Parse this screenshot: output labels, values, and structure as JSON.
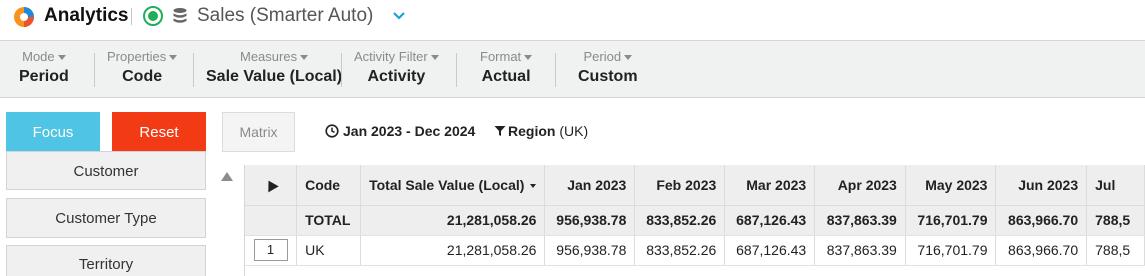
{
  "header": {
    "app_title": "Analytics",
    "dataset_title": "Sales (Smarter Auto)",
    "status_color": "#1fae5a",
    "icons": [
      "analytics-logo-icon",
      "status-online-icon",
      "database-icon",
      "chevron-down-icon"
    ]
  },
  "toolbar": {
    "groups": [
      {
        "caption": "Mode",
        "value": "Period"
      },
      {
        "caption": "Properties",
        "value": "Code"
      },
      {
        "caption": "Measures",
        "value": "Sale Value (Local)"
      },
      {
        "caption": "Activity Filter",
        "value": "Activity"
      },
      {
        "caption": "Format",
        "value": "Actual"
      },
      {
        "caption": "Period",
        "value": "Custom"
      }
    ]
  },
  "actions": {
    "focus_label": "Focus",
    "reset_label": "Reset",
    "matrix_label": "Matrix",
    "date_range": "Jan 2023 - Dec 2024",
    "filter_name": "Region",
    "filter_value": "(UK)",
    "focus_color": "#4fc4e5",
    "reset_color": "#f23a14"
  },
  "sidebar": {
    "items": [
      {
        "label": "Customer"
      },
      {
        "label": "Customer Type"
      },
      {
        "label": "Territory"
      }
    ]
  },
  "table": {
    "headers": {
      "code": "Code",
      "total": "Total Sale Value (Local)",
      "months": [
        "Jan 2023",
        "Feb 2023",
        "Mar 2023",
        "Apr 2023",
        "May 2023",
        "Jun 2023",
        "Jul"
      ]
    },
    "total_row": {
      "label": "TOTAL",
      "total": "21,281,058.26",
      "months": [
        "956,938.78",
        "833,852.26",
        "687,126.43",
        "837,863.39",
        "716,701.79",
        "863,966.70",
        "788,5"
      ]
    },
    "rows": [
      {
        "index": "1",
        "code": "UK",
        "total": "21,281,058.26",
        "months": [
          "956,938.78",
          "833,852.26",
          "687,126.43",
          "837,863.39",
          "716,701.79",
          "863,966.70",
          "788,5"
        ]
      }
    ]
  }
}
